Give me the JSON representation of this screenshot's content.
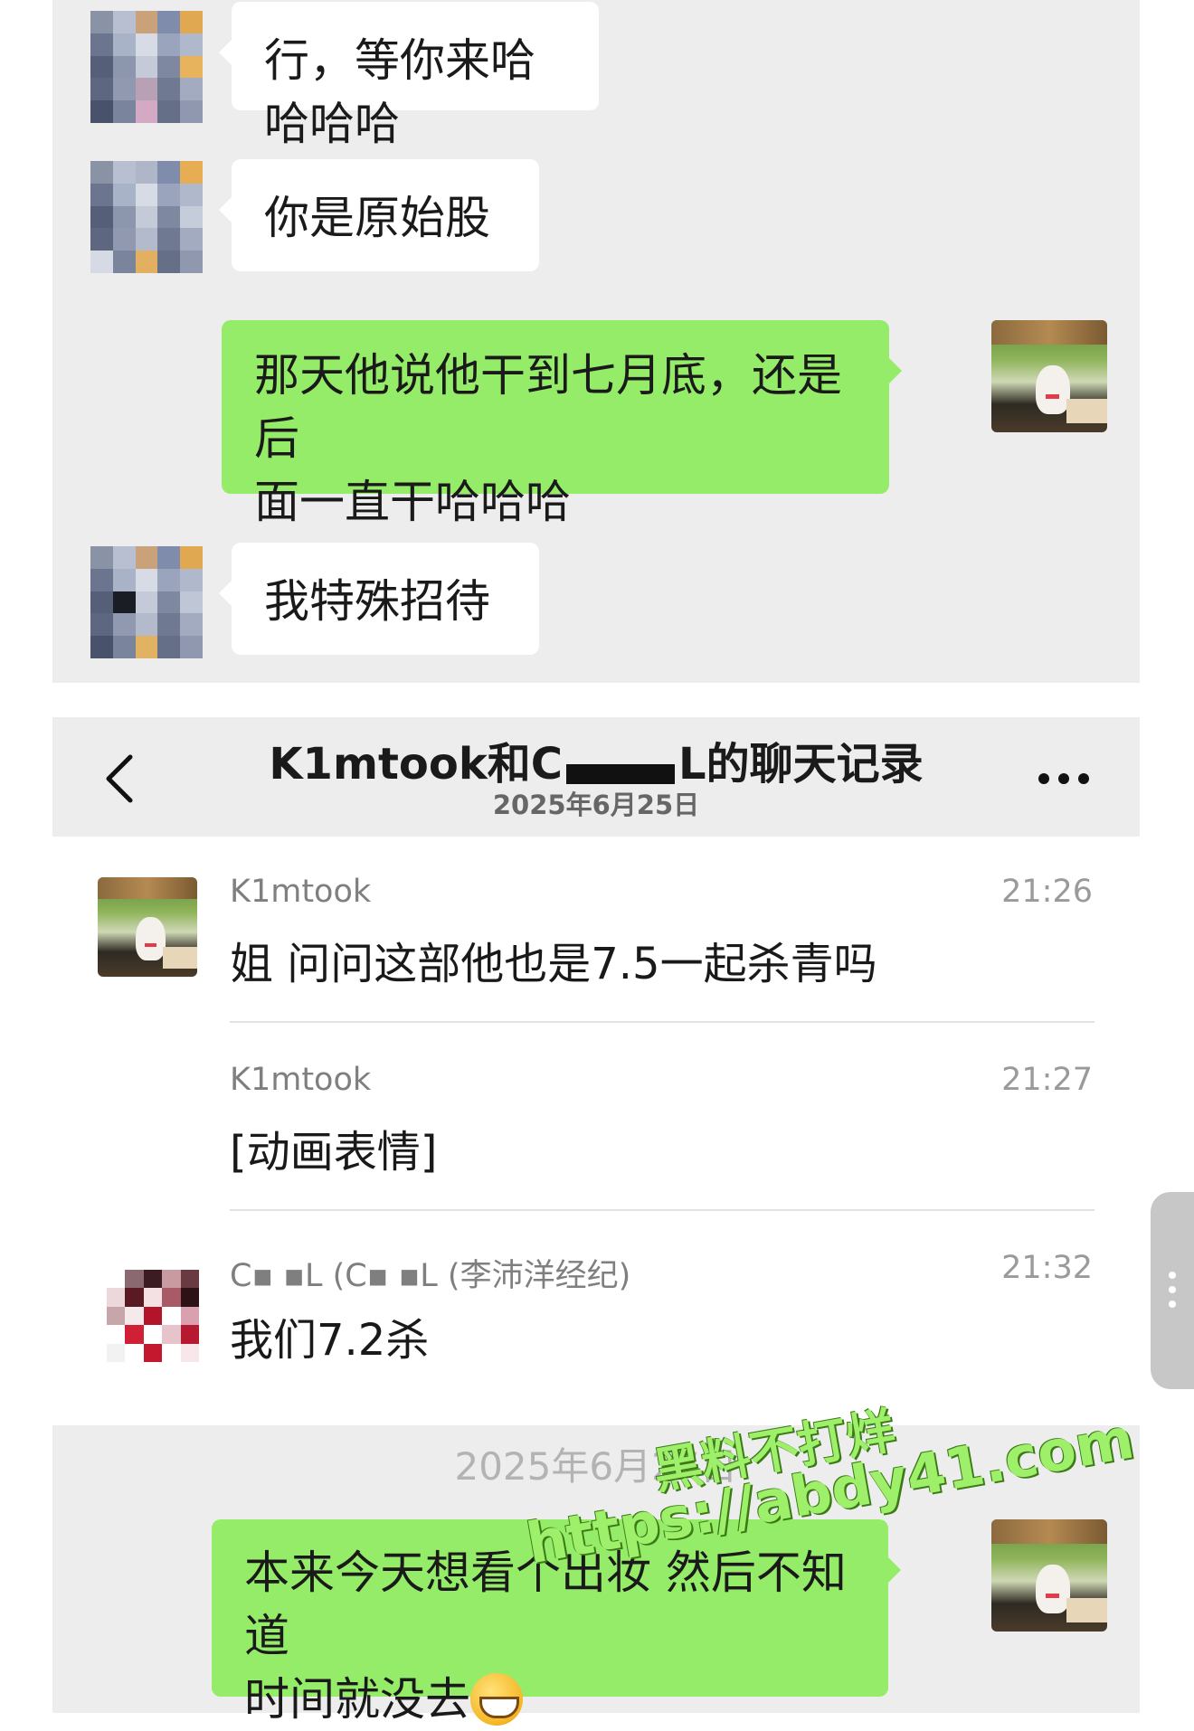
{
  "top_chat": {
    "messages": [
      {
        "side": "left",
        "text": "行，等你来哈哈哈哈"
      },
      {
        "side": "left",
        "text": "你是原始股"
      },
      {
        "side": "right",
        "line1": "那天他说他干到七月底，还是后",
        "line2": "面一直干哈哈哈"
      },
      {
        "side": "left",
        "text": "我特殊招待"
      }
    ]
  },
  "history": {
    "title_left": "K1mtook和C",
    "title_right": "L的聊天记录",
    "date": "2025年6月25日",
    "records": [
      {
        "name": "K1mtook",
        "time": "21:26",
        "text": "姐 问问这部他也是7.5一起杀青吗"
      },
      {
        "name": "K1mtook",
        "time": "21:27",
        "text": "[动画表情]"
      },
      {
        "name": "C▪ ▪L (C▪ ▪L (李沛洋经纪)",
        "time": "21:32",
        "text": "我们7.2杀"
      }
    ]
  },
  "bottom_chat": {
    "system_date": "2025年6月27日",
    "message_line1": "本来今天想看个出妆 然后不知道",
    "message_line2": "时间就没去"
  },
  "watermark": {
    "line1": "黑料不打烊",
    "line2": "https://abdy41.com"
  },
  "icons": {
    "back": "chevron-left-icon",
    "more": "more-dots-icon",
    "emoji": "grinning-emoji-icon"
  },
  "colors": {
    "chat_bg": "#ededed",
    "bubble_green": "#95ec69",
    "bubble_white": "#ffffff"
  }
}
